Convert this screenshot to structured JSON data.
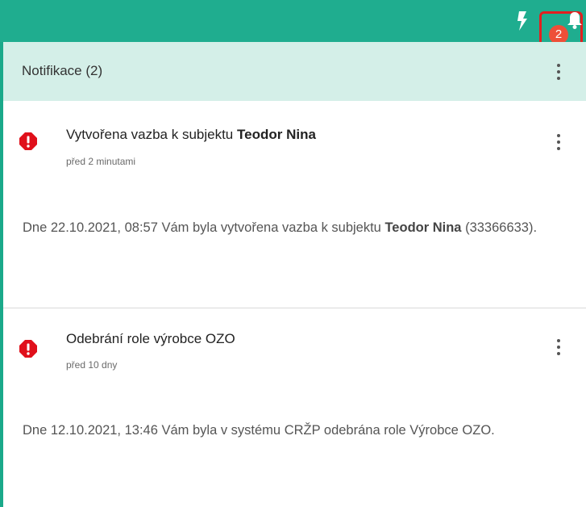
{
  "topbar": {
    "icons": [
      "bolt-icon",
      "bell-icon"
    ],
    "badge_count": "2",
    "highlight_color": "#e41f1f"
  },
  "panel": {
    "title": "Notifikace (2)"
  },
  "notifications": [
    {
      "icon": "alert-icon",
      "title_prefix": "Vytvořena vazba k subjektu ",
      "title_bold": "Teodor Nina",
      "time": "před 2 minutami",
      "body_prefix": "Dne 22.10.2021, 08:57 Vám byla vytvořena vazba k subjektu ",
      "body_bold": "Teodor Nina",
      "body_suffix": " (33366633)."
    },
    {
      "icon": "alert-icon",
      "title": "Odebrání role výrobce OZO",
      "time": "před 10 dny",
      "body": "Dne 12.10.2021, 13:46 Vám byla v systému CRŽP odebrána role Výrobce OZO."
    }
  ],
  "colors": {
    "topbar": "#1fad8f",
    "header": "#d4efe8",
    "alert": "#e0101b",
    "badge": "#ee4f38"
  }
}
